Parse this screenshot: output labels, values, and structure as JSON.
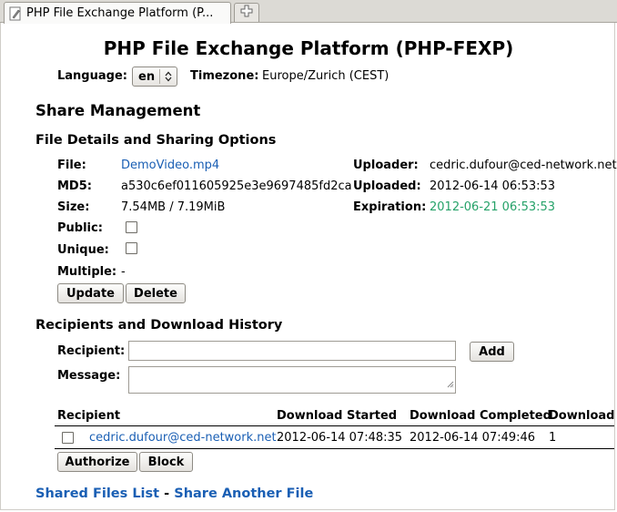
{
  "browser": {
    "tab_title": "PHP File Exchange Platform (P...",
    "new_tab_icon": "plus-icon",
    "page_icon": "pencil-icon"
  },
  "page": {
    "title": "PHP File Exchange Platform (PHP-FEXP)",
    "language_label": "Language:",
    "language_value": "en",
    "timezone_label": "Timezone:",
    "timezone_value": "Europe/Zurich (CEST)"
  },
  "share": {
    "heading": "Share Management",
    "details_heading": "File Details and Sharing Options",
    "file_label": "File:",
    "file_value": "DemoVideo.mp4",
    "md5_label": "MD5:",
    "md5_value": "a530c6ef011605925e3e9697485fd2ca",
    "size_label": "Size:",
    "size_value": "7.54MB / 7.19MiB",
    "public_label": "Public:",
    "unique_label": "Unique:",
    "multiple_label": "Multiple:",
    "multiple_value": "-",
    "uploader_label": "Uploader:",
    "uploader_value": "cedric.dufour@ced-network.net",
    "uploaded_label": "Uploaded:",
    "uploaded_value": "2012-06-14 06:53:53",
    "expiration_label": "Expiration:",
    "expiration_value": "2012-06-21 06:53:53",
    "update_button": "Update",
    "delete_button": "Delete"
  },
  "recipients": {
    "heading": "Recipients and Download History",
    "recipient_label": "Recipient:",
    "recipient_value": "",
    "message_label": "Message:",
    "message_value": "",
    "add_button": "Add",
    "table": {
      "headers": [
        "Recipient",
        "Download Started",
        "Download Completed",
        "Download"
      ],
      "rows": [
        {
          "recipient": "cedric.dufour@ced-network.net",
          "started": "2012-06-14 07:48:35",
          "completed": "2012-06-14 07:49:46",
          "count": "1"
        }
      ]
    },
    "authorize_button": "Authorize",
    "block_button": "Block"
  },
  "footer": {
    "shared_files_link": "Shared Files List",
    "separator": "-",
    "share_another_link": "Share Another File"
  },
  "colors": {
    "link": "#1a5fb4",
    "expiration": "#26a269"
  }
}
